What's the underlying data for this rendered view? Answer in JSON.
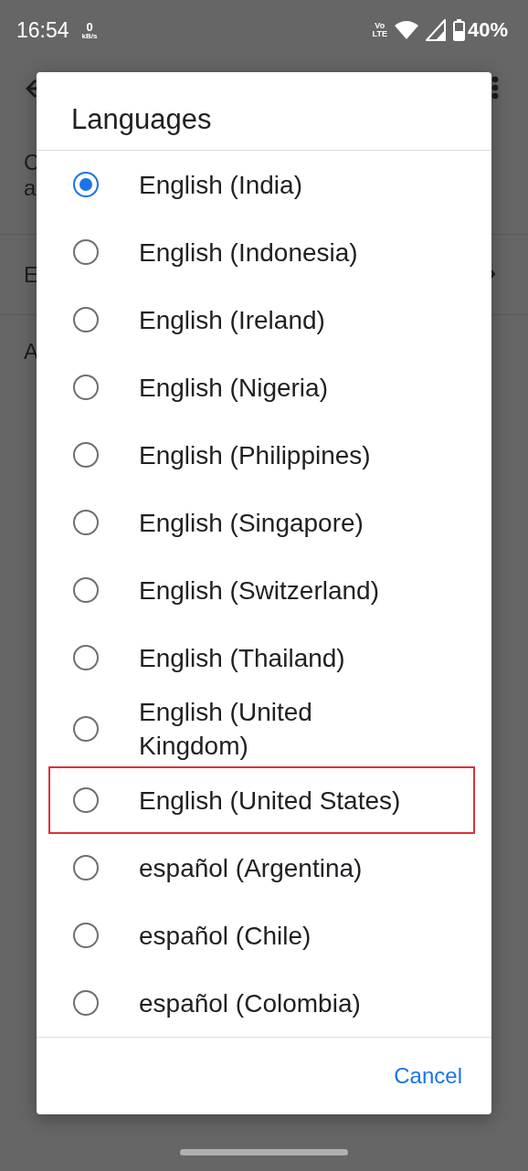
{
  "status_bar": {
    "time": "16:54",
    "speed_value": "0",
    "speed_unit": "kB/s",
    "volte_top": "Vo",
    "volte_bottom": "LTE",
    "battery": "40%"
  },
  "background": {
    "rows": [
      {
        "lines": [
          "C",
          "a"
        ]
      },
      {
        "lines": [
          "E"
        ]
      },
      {
        "lines": [
          "A"
        ]
      }
    ]
  },
  "dialog": {
    "title": "Languages",
    "options": [
      {
        "label": "English (India)",
        "selected": true,
        "highlighted": false
      },
      {
        "label": "English (Indonesia)",
        "selected": false,
        "highlighted": false
      },
      {
        "label": "English (Ireland)",
        "selected": false,
        "highlighted": false
      },
      {
        "label": "English (Nigeria)",
        "selected": false,
        "highlighted": false
      },
      {
        "label": "English (Philippines)",
        "selected": false,
        "highlighted": false
      },
      {
        "label": "English (Singapore)",
        "selected": false,
        "highlighted": false
      },
      {
        "label": "English (Switzerland)",
        "selected": false,
        "highlighted": false
      },
      {
        "label": "English (Thailand)",
        "selected": false,
        "highlighted": false
      },
      {
        "label": "English (United Kingdom)",
        "selected": false,
        "highlighted": false
      },
      {
        "label": "English (United States)",
        "selected": false,
        "highlighted": true
      },
      {
        "label": "español (Argentina)",
        "selected": false,
        "highlighted": false
      },
      {
        "label": "español (Chile)",
        "selected": false,
        "highlighted": false
      },
      {
        "label": "español (Colombia)",
        "selected": false,
        "highlighted": false
      }
    ],
    "button": "Cancel"
  }
}
